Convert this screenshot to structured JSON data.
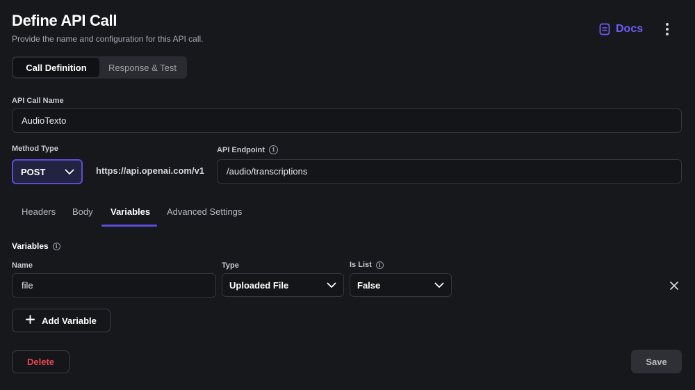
{
  "header": {
    "title": "Define API Call",
    "subtitle": "Provide the name and configuration for this API call.",
    "docs_label": "Docs"
  },
  "segments": {
    "call_definition": "Call Definition",
    "response_test": "Response & Test",
    "active": "Call Definition"
  },
  "api_call_name": {
    "label": "API Call Name",
    "value": "AudioTexto"
  },
  "method": {
    "label": "Method Type",
    "value": "POST"
  },
  "base_url": "https://api.openai.com/v1",
  "endpoint": {
    "label": "API Endpoint",
    "value": "/audio/transcriptions"
  },
  "tabs": [
    {
      "label": "Headers"
    },
    {
      "label": "Body"
    },
    {
      "label": "Variables"
    },
    {
      "label": "Advanced Settings"
    }
  ],
  "active_tab": "Variables",
  "variables": {
    "section_label": "Variables",
    "col_name": "Name",
    "col_type": "Type",
    "col_is_list": "Is List",
    "rows": [
      {
        "name": "file",
        "type": "Uploaded File",
        "is_list": "False"
      }
    ],
    "add_label": "Add Variable"
  },
  "footer": {
    "delete_label": "Delete",
    "save_label": "Save"
  },
  "colors": {
    "accent": "#5b4ddb",
    "docs": "#6d5df5",
    "danger": "#e5484d",
    "background": "#17181c"
  }
}
